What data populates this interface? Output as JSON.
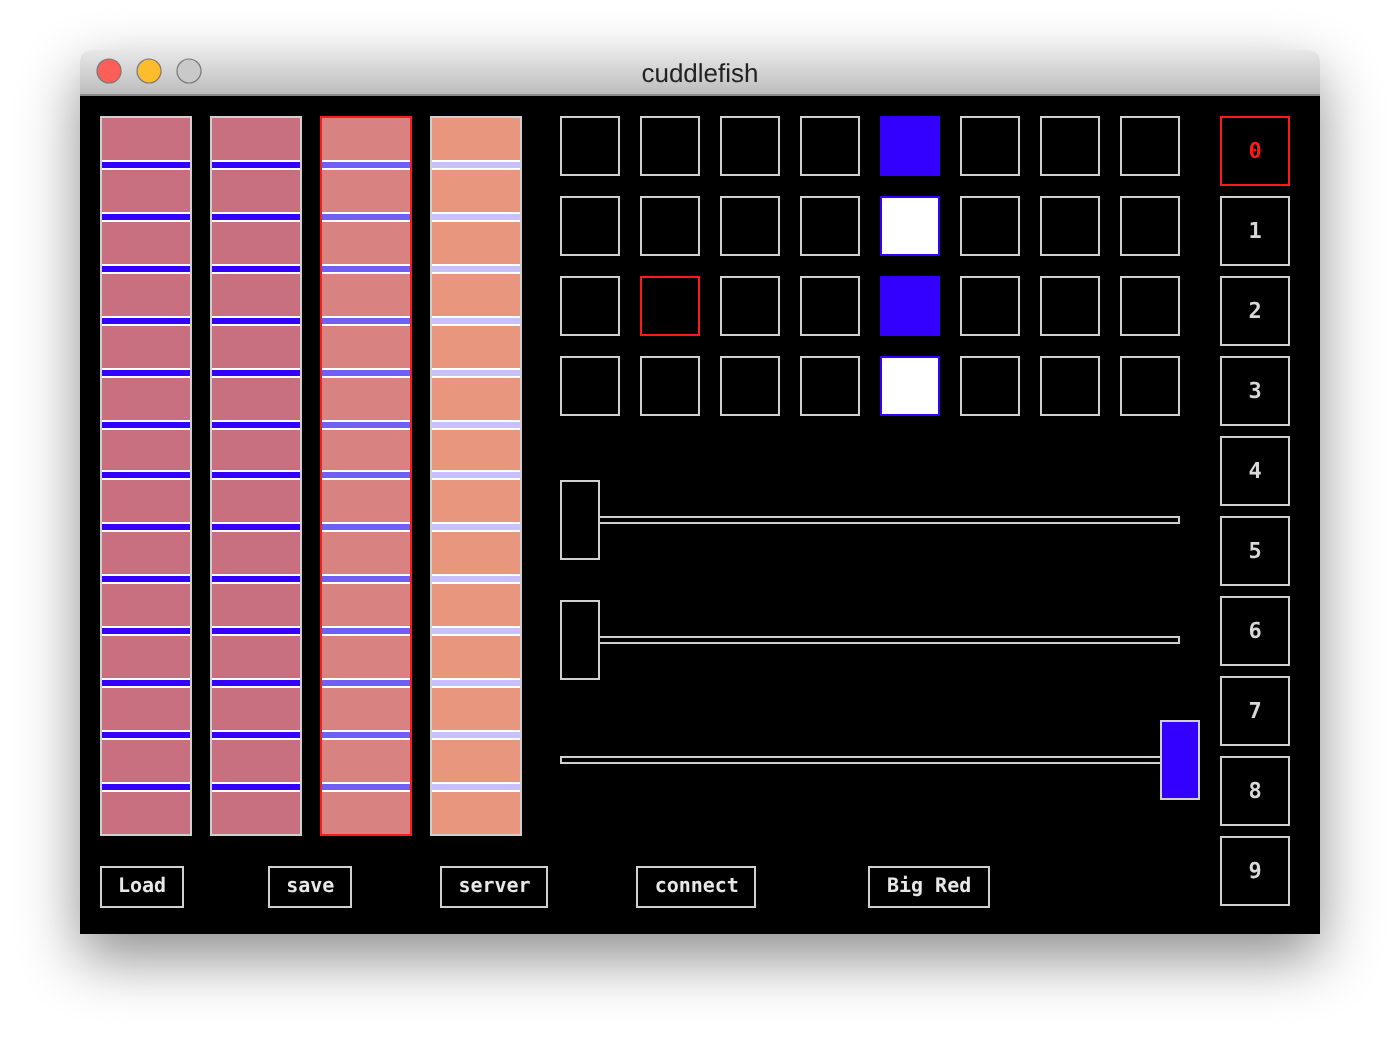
{
  "window": {
    "title": "cuddlefish"
  },
  "strips": [
    {
      "color": "#c97080",
      "selected": false,
      "marker": {
        "color": "#3300ff"
      }
    },
    {
      "color": "#c97080",
      "selected": false,
      "marker": {
        "color": "#3300ff"
      }
    },
    {
      "color": "#d98282",
      "selected": true,
      "marker": {
        "color": "#6f5ff5"
      }
    },
    {
      "color": "#e9967f",
      "selected": false,
      "marker": {
        "color": "#c8c0ff"
      }
    }
  ],
  "grid": [
    {
      "cells": [
        {
          "kind": "empty",
          "selected": false
        },
        {
          "kind": "empty",
          "selected": false
        },
        {
          "kind": "empty",
          "selected": false
        },
        {
          "kind": "empty",
          "selected": false
        },
        {
          "kind": "filled",
          "selected": false
        },
        {
          "kind": "empty",
          "selected": false
        },
        {
          "kind": "empty",
          "selected": false
        },
        {
          "kind": "empty",
          "selected": false
        }
      ]
    },
    {
      "cells": [
        {
          "kind": "empty",
          "selected": false
        },
        {
          "kind": "empty",
          "selected": false
        },
        {
          "kind": "empty",
          "selected": false
        },
        {
          "kind": "empty",
          "selected": false
        },
        {
          "kind": "bright",
          "selected": false
        },
        {
          "kind": "empty",
          "selected": false
        },
        {
          "kind": "empty",
          "selected": false
        },
        {
          "kind": "empty",
          "selected": false
        }
      ]
    },
    {
      "cells": [
        {
          "kind": "empty",
          "selected": false
        },
        {
          "kind": "empty",
          "selected": true
        },
        {
          "kind": "empty",
          "selected": false
        },
        {
          "kind": "empty",
          "selected": false
        },
        {
          "kind": "filled",
          "selected": false
        },
        {
          "kind": "empty",
          "selected": false
        },
        {
          "kind": "empty",
          "selected": false
        },
        {
          "kind": "empty",
          "selected": false
        }
      ]
    },
    {
      "cells": [
        {
          "kind": "empty",
          "selected": false
        },
        {
          "kind": "empty",
          "selected": false
        },
        {
          "kind": "empty",
          "selected": false
        },
        {
          "kind": "empty",
          "selected": false
        },
        {
          "kind": "bright",
          "selected": false
        },
        {
          "kind": "empty",
          "selected": false
        },
        {
          "kind": "empty",
          "selected": false
        },
        {
          "kind": "empty",
          "selected": false
        }
      ]
    }
  ],
  "sliders": [
    {
      "level": 0,
      "active": false
    },
    {
      "level": 0,
      "active": false
    },
    {
      "level": 1,
      "active": true
    }
  ],
  "buttons": [
    "Load",
    "save",
    "server",
    "connect",
    "Big Red"
  ],
  "numbers": [
    {
      "label": "0",
      "selected": true
    },
    {
      "label": "1",
      "selected": false
    },
    {
      "label": "2",
      "selected": false
    },
    {
      "label": "3",
      "selected": false
    },
    {
      "label": "4",
      "selected": false
    },
    {
      "label": "5",
      "selected": false
    },
    {
      "label": "6",
      "selected": false
    },
    {
      "label": "7",
      "selected": false
    },
    {
      "label": "8",
      "selected": false
    },
    {
      "label": "9",
      "selected": false
    }
  ]
}
